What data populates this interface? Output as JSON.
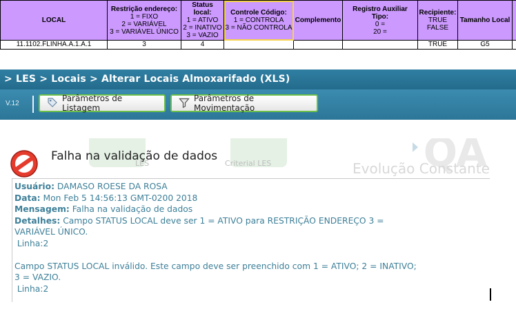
{
  "sheet": {
    "headers": [
      {
        "lines": [
          "LOCAL"
        ]
      },
      {
        "lines": [
          "Restrição endereço:",
          "1 = FIXO",
          "2 = VARIÁVEL",
          "3 = VARIÁVEL ÚNICO"
        ]
      },
      {
        "lines": [
          "Status local:",
          "1 = ATIVO",
          "2 = INATIVO",
          "3 = VAZIO"
        ]
      },
      {
        "lines": [
          "Controle Código:",
          "1 = CONTROLA",
          "3 = NÃO CONTROLA"
        ]
      },
      {
        "lines": [
          "Complemento"
        ]
      },
      {
        "lines": [
          "Registro Auxiliar Tipo:",
          "0 =",
          "20 ="
        ]
      },
      {
        "lines": [
          "Recipiente:",
          "TRUE",
          "FALSE"
        ]
      },
      {
        "lines": [
          "Tamanho Local"
        ]
      }
    ],
    "row": [
      "11.1102.FLINHA.A.1.A.1",
      "3",
      "4",
      "",
      "",
      "",
      "TRUE",
      "G5"
    ]
  },
  "les": {
    "breadcrumb": "> LES > Locais > Alterar Locais Almoxarifado (XLS)",
    "version": "V.12",
    "btn_list": "Parâmetros de Listagem",
    "btn_move": "Parâmetros de Movimentação"
  },
  "dialog": {
    "title": "Falha na validação de dados",
    "bg_tile_1": "LES",
    "bg_tile_2": "Criterial LES",
    "bg_brand": "QA",
    "bg_slogan": "Evolução Constante",
    "usuario_label": "Usuário:",
    "usuario_value": " DAMASO ROESE DA ROSA",
    "data_label": "Data:",
    "data_value": " Mon Feb 5 14:56:13 GMT-0200 2018",
    "mensagem_label": "Mensagem:",
    "mensagem_value": " Falha na validação de dados",
    "detalhes_label": "Detalhes:",
    "detalhes_line1": " Campo STATUS LOCAL deve ser 1 = ATIVO para RESTRIÇÃO ENDEREÇO 3 =",
    "detalhes_line2": "VARIÁVEL ÚNICO.",
    "linha1": " Linha:2",
    "erro2_line1": "Campo STATUS LOCAL inválido. Este campo deve ser preenchido com 1 = ATIVO; 2 = INATIVO;",
    "erro2_line2": "3 = VAZIO.",
    "linha2": " Linha:2"
  },
  "colors": {
    "header_purple": "#cc99ff",
    "les_blue": "#2f7fa3",
    "button_border": "#6abf4b",
    "message_text": "#3d7f98"
  }
}
